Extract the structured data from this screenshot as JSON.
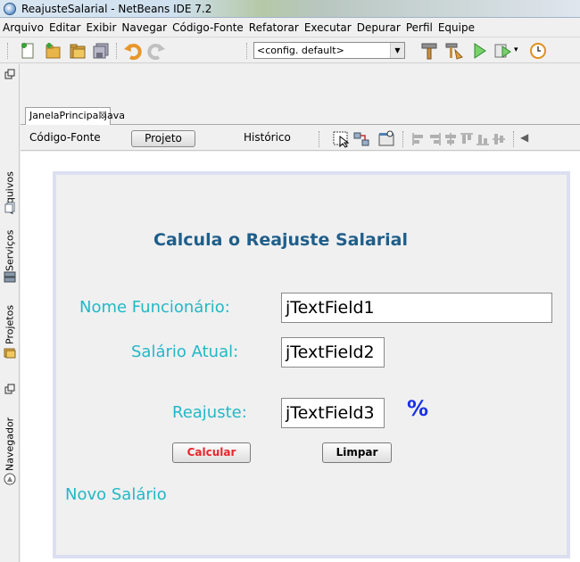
{
  "window": {
    "title": "ReajusteSalarial - NetBeans IDE 7.2"
  },
  "menubar": {
    "items": [
      "Arquivo",
      "Editar",
      "Exibir",
      "Navegar",
      "Código-Fonte",
      "Refatorar",
      "Executar",
      "Depurar",
      "Perfil",
      "Equipe"
    ]
  },
  "toolbar": {
    "config_value": "<config. default>",
    "icons": [
      "new-file-icon",
      "new-project-icon",
      "open-project-icon",
      "save-all-icon",
      "undo-icon",
      "redo-icon",
      "build-icon",
      "clean-build-icon",
      "run-icon",
      "debug-icon",
      "profile-icon"
    ]
  },
  "sidebar": {
    "tabs": [
      "Arquivos",
      "Serviços",
      "Projetos",
      "Navegador"
    ]
  },
  "editor": {
    "tab_label": "JanelaPrincipal.java",
    "close_glyph": "⊠",
    "modes": [
      "Código-Fonte",
      "Projeto",
      "Histórico"
    ],
    "active_mode": "Projeto"
  },
  "form": {
    "title": "Calcula o Reajuste Salarial",
    "name_label": "Nome Funcionário:",
    "name_value": "jTextField1",
    "salary_label": "Salário Atual:",
    "salary_value": "jTextField2",
    "raise_label": "Reajuste:",
    "raise_value": "jTextField3",
    "percent_symbol": "%",
    "calc_button": "Calcular",
    "clear_button": "Limpar",
    "result_label": "Novo Salário"
  },
  "colors": {
    "label": "#22b8c6",
    "title": "#1f5e8a",
    "percent": "#1a2fe8",
    "calc_text": "#e8262c",
    "frame_border": "#dcdff0"
  }
}
